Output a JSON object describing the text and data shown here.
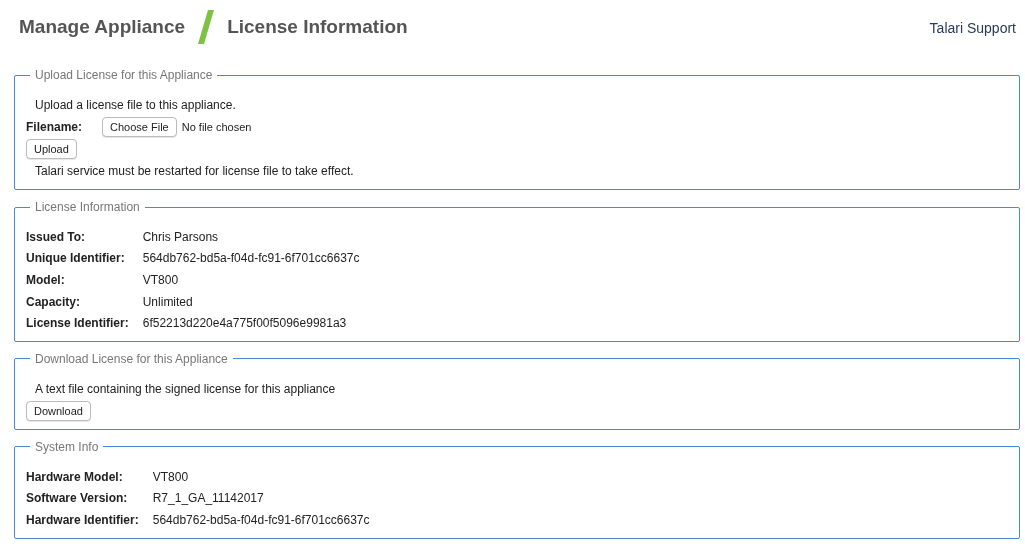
{
  "header": {
    "title": "Manage Appliance",
    "subtitle": "License Information",
    "support_link": "Talari Support"
  },
  "sections": [
    {
      "legend": "Upload License for this Appliance",
      "items": [
        {
          "kind": "text",
          "text": "Upload a license file to this appliance."
        },
        {
          "kind": "file",
          "label": "Filename:",
          "button": "Choose File",
          "status": "No file chosen"
        },
        {
          "kind": "button",
          "label": "Upload"
        },
        {
          "kind": "text",
          "text": "Talari service must be restarted for license file to take effect."
        }
      ]
    },
    {
      "legend": "License Information",
      "items": [
        {
          "kind": "row",
          "label": "Issued To:",
          "value": "Chris Parsons"
        },
        {
          "kind": "row",
          "label": "Unique Identifier:",
          "value": "564db762-bd5a-f04d-fc91-6f701cc6637c"
        },
        {
          "kind": "row",
          "label": "Model:",
          "value": "VT800"
        },
        {
          "kind": "row",
          "label": "Capacity:",
          "value": "Unlimited"
        },
        {
          "kind": "row",
          "label": "License Identifier:",
          "value": "6f52213d220e4a775f00f5096e9981a3"
        }
      ]
    },
    {
      "legend": "Download License for this Appliance",
      "items": [
        {
          "kind": "text",
          "text": "A text file containing the signed license for this appliance"
        },
        {
          "kind": "button",
          "label": "Download"
        }
      ]
    },
    {
      "legend": "System Info",
      "items": [
        {
          "kind": "row",
          "label": "Hardware Model:",
          "value": "VT800"
        },
        {
          "kind": "row",
          "label": "Software Version:",
          "value": "R7_1_GA_11142017"
        },
        {
          "kind": "row",
          "label": "Hardware Identifier:",
          "value": "564db762-bd5a-f04d-fc91-6f701cc6637c"
        }
      ]
    }
  ]
}
